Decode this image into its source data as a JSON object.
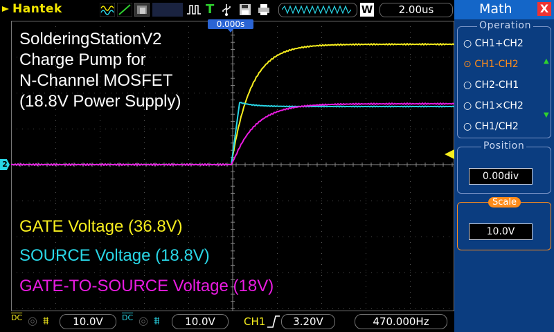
{
  "brand": "Hantek",
  "topbar": {
    "run_state": "T",
    "timebase": "2.00us",
    "window_letter": "W",
    "trigger_time": "0.000s"
  },
  "waveform_annotations": {
    "title_lines": [
      "SolderingStationV2",
      "Charge Pump for",
      "N-Channel MOSFET",
      "(18.8V Power Supply)"
    ],
    "legend": [
      {
        "text": "GATE Voltage (36.8V)",
        "color": "#f7ee1e"
      },
      {
        "text": "SOURCE Voltage (18.8V)",
        "color": "#29d6e6"
      },
      {
        "text": "GATE-TO-SOURCE Voltage (18V)",
        "color": "#e81be0"
      }
    ]
  },
  "channel_marker": "2",
  "bottombar": {
    "ch1_coupling": "DC",
    "ch1_scale": "10.0V",
    "ch2_coupling": "DC",
    "ch2_scale": "10.0V",
    "trigger_channel": "CH1",
    "trigger_level": "3.20V",
    "frequency": "470.000Hz"
  },
  "math_panel": {
    "title": "Math",
    "close_label": "X",
    "operation_title": "Operation",
    "operations": [
      {
        "label": "CH1+CH2",
        "selected": false
      },
      {
        "label": "CH1-CH2",
        "selected": true
      },
      {
        "label": "CH2-CH1",
        "selected": false
      },
      {
        "label": "CH1×CH2",
        "selected": false
      },
      {
        "label": "CH1/CH2",
        "selected": false
      }
    ],
    "position_title": "Position",
    "position_value": "0.00div",
    "scale_title": "Scale",
    "scale_value": "10.0V"
  },
  "colors": {
    "ch1": "#f7ee1e",
    "ch2": "#29d6e6",
    "math": "#e81be0",
    "panel_bg": "#0b3d80",
    "panel_header": "#1466c8",
    "accent_orange": "#ff8c1a"
  }
}
